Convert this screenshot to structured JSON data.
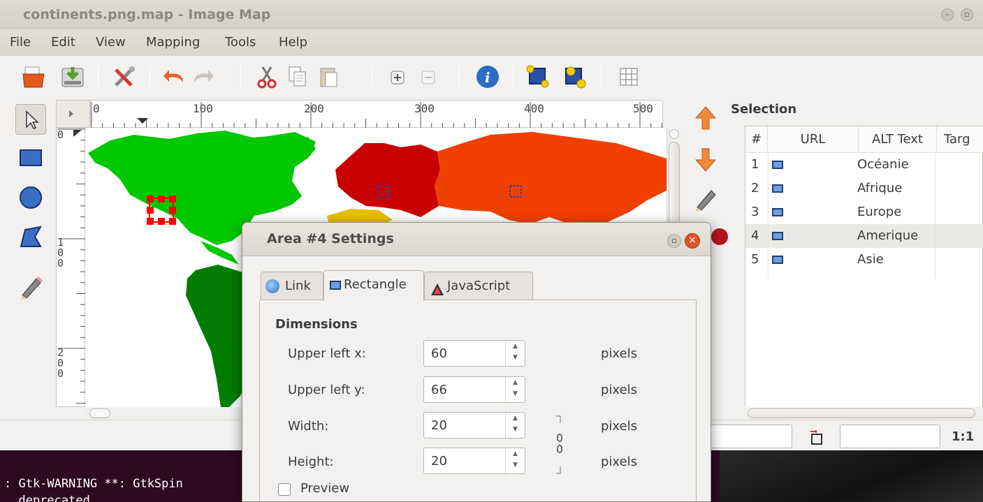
{
  "window": {
    "title": "continents.png.map - Image Map",
    "minimize_glyph": "–",
    "maximize_glyph": "▫"
  },
  "menu": [
    "File",
    "Edit",
    "View",
    "Mapping",
    "Tools",
    "Help"
  ],
  "toolbar": {
    "icons": [
      "open-icon",
      "save-icon",
      "preferences-icon",
      "undo-icon",
      "redo-icon",
      "cut-icon",
      "copy-icon",
      "paste-icon",
      "zoom-in-icon",
      "zoom-out-icon",
      "info-icon",
      "to-front-icon",
      "to-back-icon",
      "grid-icon"
    ]
  },
  "tools": [
    "pointer-icon",
    "rectangle-icon",
    "circle-icon",
    "polygon-icon",
    "edit-pencil-icon"
  ],
  "ruler": {
    "h_labels": [
      "0",
      "100",
      "200",
      "300",
      "400",
      "500"
    ],
    "v_labels": [
      "0",
      "1\n0\n0",
      "2\n0\n0"
    ]
  },
  "selection": {
    "title": "Selection",
    "columns": [
      "#",
      "URL",
      "ALT Text",
      "Targ"
    ],
    "rows": [
      {
        "index": "1",
        "alt": "Océanie",
        "selected": false
      },
      {
        "index": "2",
        "alt": "Afrique",
        "selected": false
      },
      {
        "index": "3",
        "alt": "Europe",
        "selected": false
      },
      {
        "index": "4",
        "alt": "Amerique",
        "selected": true
      },
      {
        "index": "5",
        "alt": "Asie",
        "selected": false
      }
    ]
  },
  "statusbar": {
    "zoom": "1:1"
  },
  "terminal": {
    "line1": ": Gtk-WARNING **: GtkSpin",
    "line2": "  deprecated"
  },
  "dialog": {
    "title": "Area #4 Settings",
    "tabs": [
      {
        "label": "Link",
        "icon": "globe-icon"
      },
      {
        "label": "Rectangle",
        "icon": "rectangle-icon"
      },
      {
        "label": "JavaScript",
        "icon": "javascript-icon"
      }
    ],
    "section": "Dimensions",
    "fields": [
      {
        "label": "Upper left x:",
        "value": "60",
        "unit": "pixels"
      },
      {
        "label": "Upper left y:",
        "value": "66",
        "unit": "pixels"
      },
      {
        "label": "Width:",
        "value": "20",
        "unit": "pixels"
      },
      {
        "label": "Height:",
        "value": "20",
        "unit": "pixels"
      }
    ],
    "preview_label": "Preview"
  },
  "colors": {
    "america_north": "#00c800",
    "america_south": "#007d00",
    "europe": "#c80000",
    "asia": "#f04000",
    "africa": "#e8c000",
    "selection_handle": "#ff0000",
    "close_button": "#e4522b"
  }
}
